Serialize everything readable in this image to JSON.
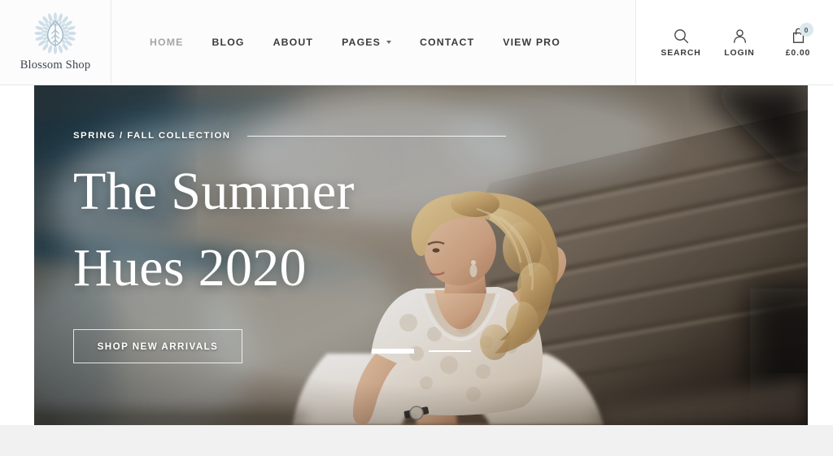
{
  "brand": {
    "name": "Blossom Shop",
    "logo_icon": "leaf-burst-icon",
    "logo_color": "#c3d6e2"
  },
  "nav": {
    "items": [
      {
        "label": "HOME",
        "active": true,
        "has_dropdown": false
      },
      {
        "label": "BLOG",
        "active": false,
        "has_dropdown": false
      },
      {
        "label": "ABOUT",
        "active": false,
        "has_dropdown": false
      },
      {
        "label": "PAGES",
        "active": false,
        "has_dropdown": true
      },
      {
        "label": "CONTACT",
        "active": false,
        "has_dropdown": false
      },
      {
        "label": "VIEW PRO",
        "active": false,
        "has_dropdown": false
      }
    ]
  },
  "actions": {
    "search": {
      "label": "SEARCH",
      "icon": "search-icon"
    },
    "login": {
      "label": "LOGIN",
      "icon": "user-icon"
    },
    "cart": {
      "label": "£0.00",
      "icon": "shopping-bag-icon",
      "count": "0",
      "badge_color": "#dde7ee"
    }
  },
  "hero": {
    "eyebrow": "SPRING / FALL COLLECTION",
    "title": "The Summer\nHues 2020",
    "cta_label": "SHOP NEW ARRIVALS",
    "slides": [
      {
        "index": "1",
        "active": true
      },
      {
        "index": "2",
        "active": false
      }
    ],
    "image_alt": "Woman in white lace dress seated on concrete steps with blue smoke"
  }
}
